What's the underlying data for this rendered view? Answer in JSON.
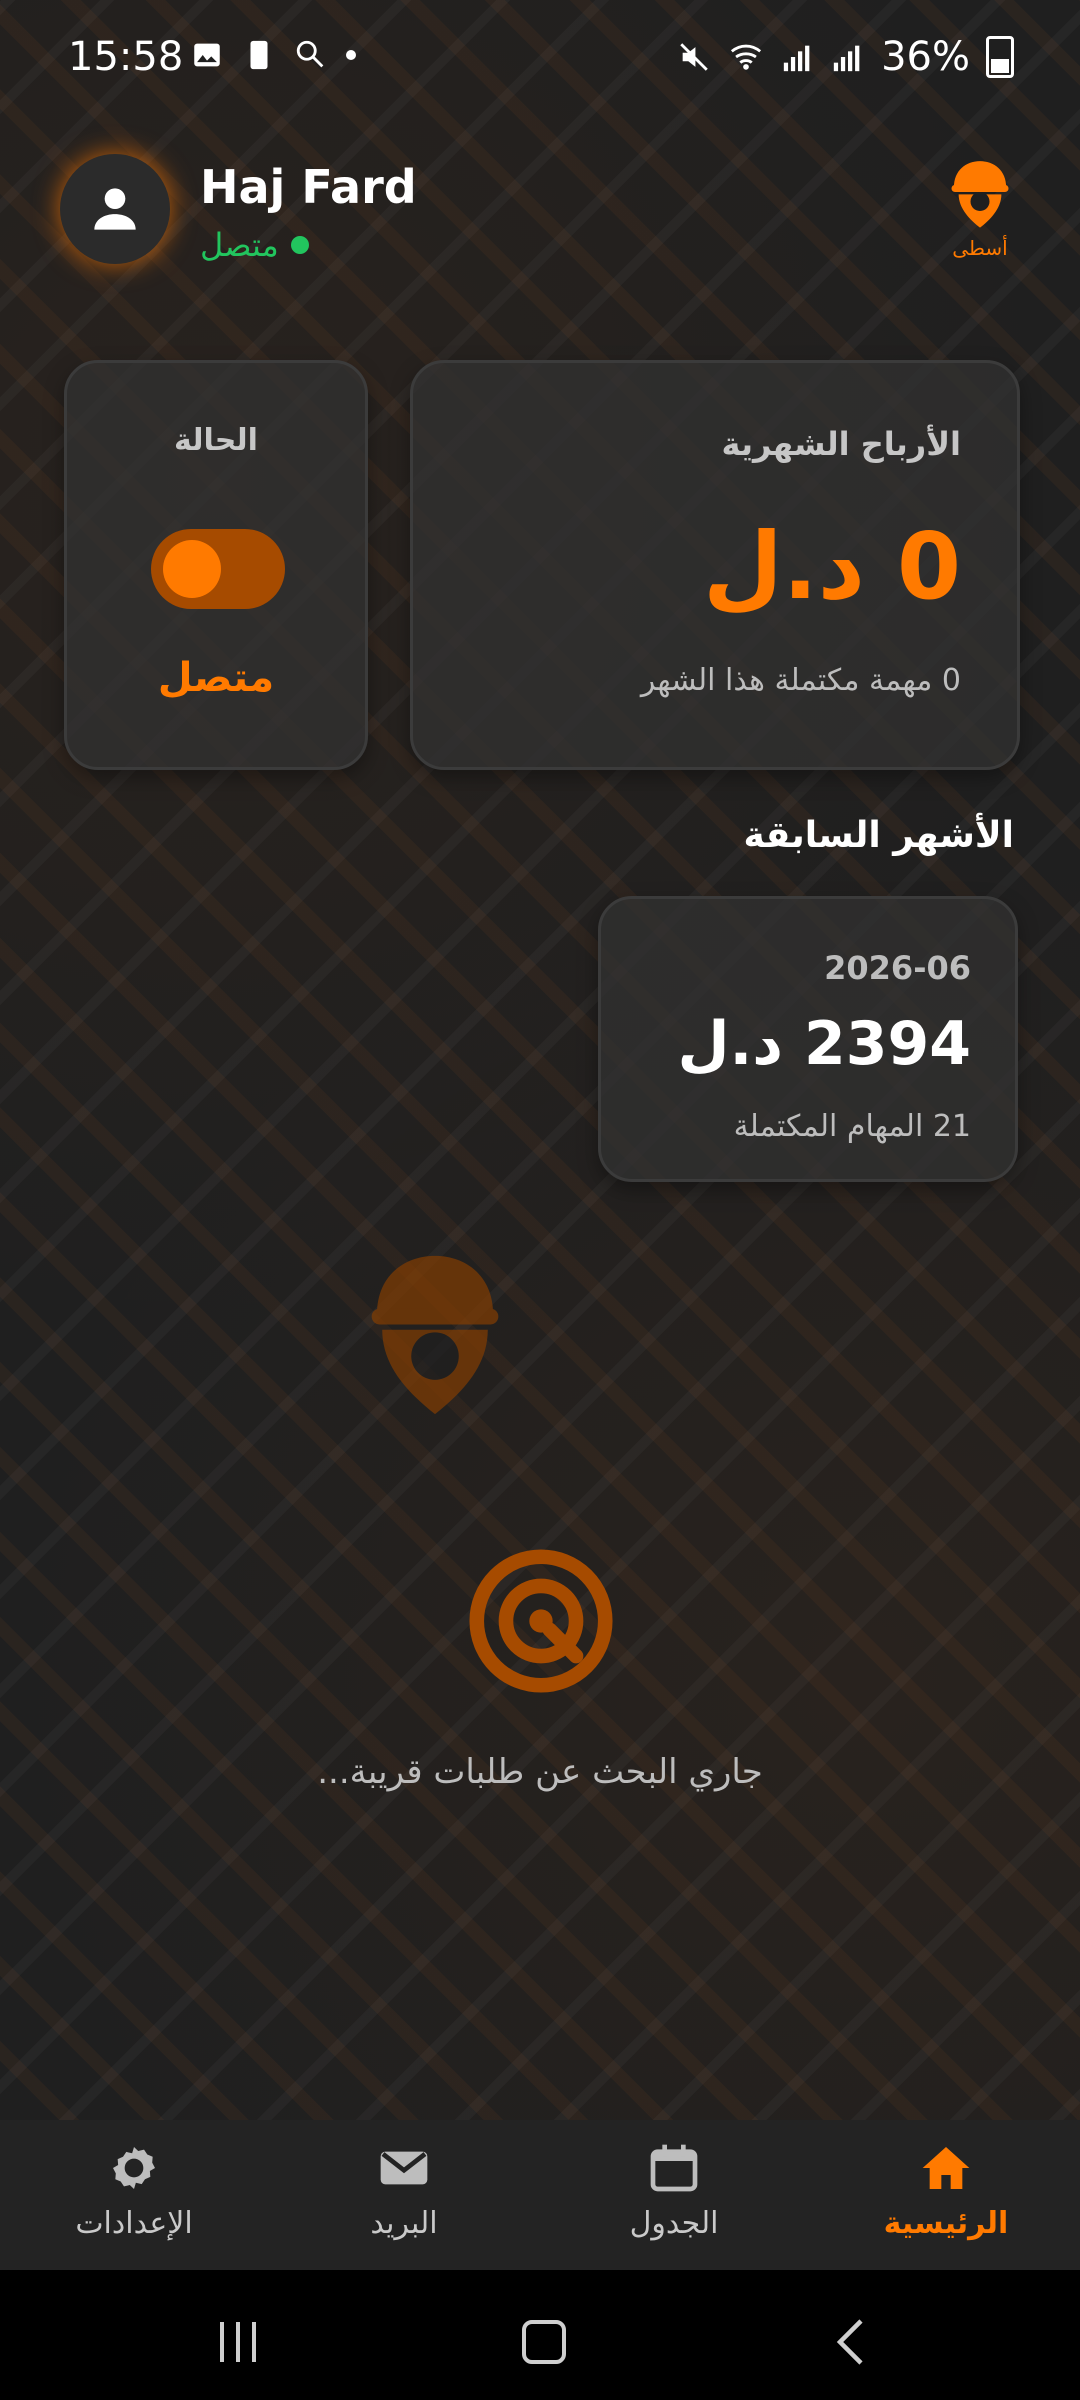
{
  "status_bar": {
    "time": "15:58",
    "battery": "36%"
  },
  "header": {
    "user_name": "Haj Fard",
    "online_status": "متصل",
    "brand_name": "أسطى"
  },
  "status_card": {
    "title": "الحالة",
    "value": "متصل",
    "toggle_on": true
  },
  "earnings_card": {
    "title": "الأرباح الشهرية",
    "amount": "0 د.ل",
    "completed_text": "0 مهمة مكتملة هذا الشهر"
  },
  "previous_months": {
    "title": "الأشهر السابقة",
    "items": [
      {
        "date": "2026-06",
        "amount": "2394 د.ل",
        "completed": "21 المهام المكتملة"
      }
    ]
  },
  "search": {
    "text": "جاري البحث عن طلبات قريبة..."
  },
  "bottom_nav": {
    "items": [
      {
        "label": "الإعدادات",
        "icon": "gear-icon"
      },
      {
        "label": "البريد",
        "icon": "mail-icon"
      },
      {
        "label": "الجدول",
        "icon": "calendar-icon"
      },
      {
        "label": "الرئيسية",
        "icon": "home-icon",
        "active": true
      }
    ]
  },
  "colors": {
    "accent": "#ff7a00",
    "online": "#22c55e"
  }
}
